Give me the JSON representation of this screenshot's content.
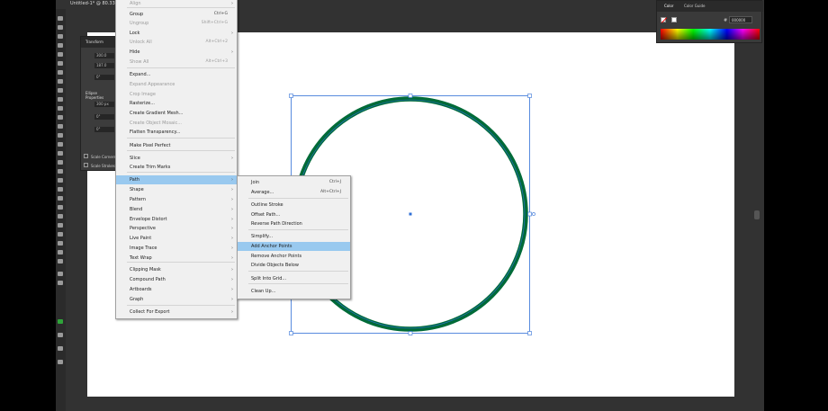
{
  "document": {
    "tab_title": "Untitled-1* @ 80.33"
  },
  "colors": {
    "stroke": "#006b38",
    "selection": "#2f6fd6",
    "menu_highlight": "#99c9ef"
  },
  "transform_panel": {
    "title": "Transform",
    "fields": [
      "300.0",
      "187.0"
    ],
    "angle": "0°",
    "ellipse_title": "Ellipse Properties",
    "ellipse_width": "300 px",
    "rotate": "0°",
    "pie_start": "0°",
    "scale_corners": "Scale Corners",
    "scale_strokes": "Scale Strokes & Effects"
  },
  "color_panel": {
    "tab_color": "Color",
    "tab_guide": "Color Guide",
    "hex_label": "#",
    "hex_value": "000000"
  },
  "object_menu": {
    "items": [
      {
        "label": "Align",
        "shortcut": "",
        "disabled": true,
        "submenu": true
      },
      {
        "label": "Group",
        "shortcut": "Ctrl+G",
        "disabled": false,
        "submenu": false
      },
      {
        "label": "Ungroup",
        "shortcut": "Shift+Ctrl+G",
        "disabled": true,
        "submenu": false
      },
      {
        "label": "Lock",
        "shortcut": "",
        "disabled": false,
        "submenu": true
      },
      {
        "label": "Unlock All",
        "shortcut": "Alt+Ctrl+2",
        "disabled": true,
        "submenu": false
      },
      {
        "label": "Hide",
        "shortcut": "",
        "disabled": false,
        "submenu": true
      },
      {
        "label": "Show All",
        "shortcut": "Alt+Ctrl+3",
        "disabled": true,
        "submenu": false
      },
      {
        "label": "Expand...",
        "shortcut": "",
        "disabled": false,
        "submenu": false
      },
      {
        "label": "Expand Appearance",
        "shortcut": "",
        "disabled": true,
        "submenu": false
      },
      {
        "label": "Crop Image",
        "shortcut": "",
        "disabled": true,
        "submenu": false
      },
      {
        "label": "Rasterize...",
        "shortcut": "",
        "disabled": false,
        "submenu": false
      },
      {
        "label": "Create Gradient Mesh...",
        "shortcut": "",
        "disabled": false,
        "submenu": false
      },
      {
        "label": "Create Object Mosaic...",
        "shortcut": "",
        "disabled": true,
        "submenu": false
      },
      {
        "label": "Flatten Transparency...",
        "shortcut": "",
        "disabled": false,
        "submenu": false
      },
      {
        "label": "Make Pixel Perfect",
        "shortcut": "",
        "disabled": false,
        "submenu": false
      },
      {
        "label": "Slice",
        "shortcut": "",
        "disabled": false,
        "submenu": true
      },
      {
        "label": "Create Trim Marks",
        "shortcut": "",
        "disabled": false,
        "submenu": false
      },
      {
        "label": "Path",
        "shortcut": "",
        "disabled": false,
        "submenu": true,
        "highlighted": true
      },
      {
        "label": "Shape",
        "shortcut": "",
        "disabled": false,
        "submenu": true
      },
      {
        "label": "Pattern",
        "shortcut": "",
        "disabled": false,
        "submenu": true
      },
      {
        "label": "Blend",
        "shortcut": "",
        "disabled": false,
        "submenu": true
      },
      {
        "label": "Envelope Distort",
        "shortcut": "",
        "disabled": false,
        "submenu": true
      },
      {
        "label": "Perspective",
        "shortcut": "",
        "disabled": false,
        "submenu": true
      },
      {
        "label": "Live Paint",
        "shortcut": "",
        "disabled": false,
        "submenu": true
      },
      {
        "label": "Image Trace",
        "shortcut": "",
        "disabled": false,
        "submenu": true
      },
      {
        "label": "Text Wrap",
        "shortcut": "",
        "disabled": false,
        "submenu": true
      },
      {
        "label": "Clipping Mask",
        "shortcut": "",
        "disabled": false,
        "submenu": true
      },
      {
        "label": "Compound Path",
        "shortcut": "",
        "disabled": false,
        "submenu": true
      },
      {
        "label": "Artboards",
        "shortcut": "",
        "disabled": false,
        "submenu": true
      },
      {
        "label": "Graph",
        "shortcut": "",
        "disabled": false,
        "submenu": true
      },
      {
        "label": "Collect For Export",
        "shortcut": "",
        "disabled": false,
        "submenu": true
      }
    ]
  },
  "path_submenu": {
    "items": [
      {
        "label": "Join",
        "shortcut": "Ctrl+J"
      },
      {
        "label": "Average...",
        "shortcut": "Alt+Ctrl+J"
      },
      {
        "label": "Outline Stroke",
        "shortcut": ""
      },
      {
        "label": "Offset Path...",
        "shortcut": ""
      },
      {
        "label": "Reverse Path Direction",
        "shortcut": ""
      },
      {
        "label": "Simplify...",
        "shortcut": ""
      },
      {
        "label": "Add Anchor Points",
        "shortcut": "",
        "highlighted": true
      },
      {
        "label": "Remove Anchor Points",
        "shortcut": ""
      },
      {
        "label": "Divide Objects Below",
        "shortcut": ""
      },
      {
        "label": "Split Into Grid...",
        "shortcut": ""
      },
      {
        "label": "Clean Up...",
        "shortcut": ""
      }
    ]
  }
}
